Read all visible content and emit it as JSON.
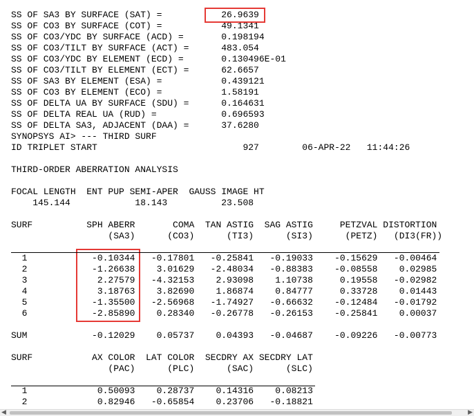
{
  "lines": [
    "SS OF SA3 BY SURFACE (SAT) =           26.9639",
    "SS OF CO3 BY SURFACE (COT) =           49.1341",
    "SS OF CO3/YDC BY SURFACE (ACD) =       0.198194",
    "SS OF CO3/TILT BY SURFACE (ACT) =      483.054",
    "SS OF CO3/YDC BY ELEMENT (ECD) =       0.130496E-01",
    "SS OF CO3/TILT BY ELEMENT (ECT) =      62.6657",
    "SS OF SA3 BY ELEMENT (ESA) =           0.439121",
    "SS OF CO3 BY ELEMENT (ECO) =           1.58191",
    "SS OF DELTA UA BY SURFACE (SDU) =      0.164631",
    "SS OF DELTA REAL UA (RUD) =            0.696593",
    "SS OF DELTA SA3, ADJACENT (DAA) =      37.6280",
    "SYNOPSYS AI> --- THIRD SURF",
    "ID TRIPLET START                           927        06-APR-22   11:44:26",
    "",
    "THIRD-ORDER ABERRATION ANALYSIS",
    "",
    "FOCAL LENGTH  ENT PUP SEMI-APER  GAUSS IMAGE HT",
    "    145.144            18.143          23.508",
    "",
    "SURF          SPH ABERR       COMA  TAN ASTIG  SAG ASTIG     PETZVAL DISTORTION",
    "                  (SA3)      (CO3)      (TI3)      (SI3)      (PETZ)   (DI3(FR))",
    "",
    "  1            -0.10344   -0.17801   -0.25841   -0.19033    -0.15629   -0.00464",
    "  2            -1.26638    3.01629   -2.48034   -0.88383    -0.08558    0.02985",
    "  3             2.27579   -4.32153    2.93098    1.10738     0.19558   -0.02982",
    "  4             3.18763    3.82690    1.86874    0.84777     0.33728    0.01443",
    "  5            -1.35500   -2.56968   -1.74927   -0.66632    -0.12484   -0.01792",
    "  6            -2.85890    0.28340   -0.26778   -0.26153    -0.25841    0.00037",
    "",
    "SUM            -0.12029    0.05737    0.04393   -0.04687    -0.09226   -0.00773",
    "",
    "SURF           AX COLOR  LAT COLOR  SECDRY AX SECDRY LAT",
    "                  (PAC)      (PLC)      (SAC)      (SLC)",
    "",
    "  1             0.50093    0.28737    0.14316    0.08213",
    "  2             0.82946   -0.65854    0.23706   -0.18821"
  ],
  "scrollbar": {
    "left_arrow": "◀",
    "right_arrow": "▶"
  }
}
